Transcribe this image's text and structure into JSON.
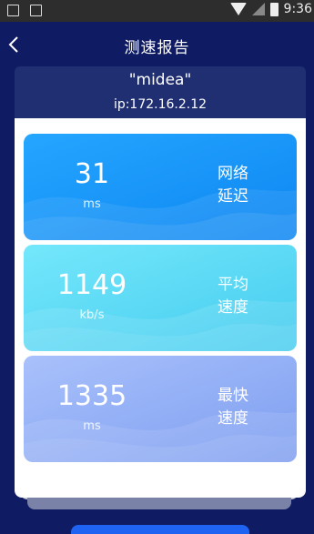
{
  "status_bar": {
    "time": "9:36"
  },
  "header": {
    "title": "测速报告"
  },
  "device": {
    "name": "\"midea\"",
    "ip": "ip:172.16.2.12"
  },
  "metrics": [
    {
      "value": "31",
      "unit": "ms",
      "label_line1": "网络",
      "label_line2": "延迟"
    },
    {
      "value": "1149",
      "unit": "kb/s",
      "label_line1": "平均",
      "label_line2": "速度"
    },
    {
      "value": "1335",
      "unit": "ms",
      "label_line1": "最快",
      "label_line2": "速度"
    }
  ],
  "colors": {
    "background": "#0f1c63",
    "card_latency": "#1a96fb",
    "card_average": "#5ad8f5",
    "card_fastest": "#8faaf5",
    "button": "#1e63f1"
  }
}
